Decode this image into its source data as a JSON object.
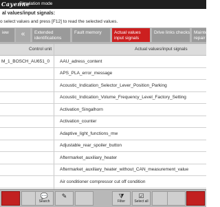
{
  "topbar": {
    "brand": "Cayenne",
    "mode": "Simulation mode"
  },
  "header": {
    "title": "al values/input signals:",
    "subtitle": "o select values and press [F12] to read the selected values."
  },
  "tabs": [
    {
      "label": "iew",
      "state": "normal"
    },
    {
      "label": "«",
      "state": "back"
    },
    {
      "label": "Extended identifications",
      "state": "normal"
    },
    {
      "label": "Fault memory",
      "state": "normal"
    },
    {
      "label": "Actual values input signals",
      "state": "active"
    },
    {
      "label": "Drive links checks",
      "state": "normal"
    },
    {
      "label": "Mainte repair",
      "state": "normal"
    }
  ],
  "table": {
    "col_control_unit": "Control unit",
    "col_signals": "Actual values/input signals",
    "control_unit_value": "M_1_BOSCH_AU651_0",
    "rows": [
      "AAU_adress_content",
      "APS_PLA_error_message",
      "Acoustic_Indication_Selector_Lever_Position_Parking",
      "Acoustic_Indication_Volume_Frequency_Level_Factory_Setting",
      "Activation_Singalhorn",
      "Activation_counter",
      "Adaptive_light_functions_mw",
      "Adjustable_rear_spoiler_button",
      "Aftermarket_auxiliary_heater",
      "Aftermarket_auxiliary_heater_without_CAN_measurement_value",
      "Air conditioner compressor cut off condition"
    ]
  },
  "toolbar": {
    "buttons": [
      {
        "icon": "",
        "label": ""
      },
      {
        "icon": "",
        "label": ""
      },
      {
        "icon": "💬",
        "label": "Search"
      },
      {
        "icon": "✎",
        "label": ""
      },
      {
        "icon": "",
        "label": ""
      },
      {
        "icon": "⧩",
        "label": "Filter"
      },
      {
        "icon": "☑",
        "label": "Select all"
      },
      {
        "icon": "",
        "label": ""
      },
      {
        "icon": "",
        "label": ""
      },
      {
        "icon": "",
        "label": ""
      }
    ]
  },
  "colors": {
    "accent": "#cc1f1f",
    "tab_bg": "#9a9a9a",
    "topbar": "#1f1f1f"
  }
}
